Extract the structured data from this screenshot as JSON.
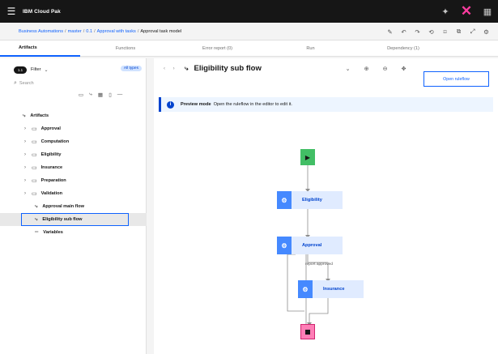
{
  "app": {
    "brand": "IBM Cloud Pak",
    "menu_icon": "hamburger-icon",
    "top_icons": [
      "pin-icon",
      "close-icon",
      "grid-icon"
    ]
  },
  "breadcrumb": {
    "items": [
      "Business Automations",
      "master",
      "0.1",
      "Approval with tasks"
    ],
    "current": "Approval task model",
    "tools": [
      "edit-icon",
      "undo-icon",
      "redo-icon",
      "history-icon",
      "tag-icon",
      "copy-icon",
      "fullscreen-icon",
      "settings-icon"
    ]
  },
  "tabs": [
    "Artifacts",
    "Functions",
    "Error report (0)",
    "Run",
    "Dependency (1)"
  ],
  "sidebar": {
    "toggle_label": "1.1",
    "filter_label": "Filter",
    "all_types": "All types",
    "search_placeholder": "Search",
    "tree": {
      "root": "Artifacts",
      "folders": [
        "Approval",
        "Computation",
        "Eligibility",
        "Insurance",
        "Preparation",
        "Validation"
      ],
      "flows": [
        "Approval main flow",
        "Eligibility sub flow"
      ],
      "variables": "Variables",
      "selected": "Eligibility sub flow"
    }
  },
  "editor": {
    "title": "Eligibility sub flow",
    "open_button": "Open ruleflow",
    "banner_bold": "Preview mode",
    "banner_text": "Open the ruleflow in the editor to edit it.",
    "tasks": [
      "Eligibility",
      "Approval",
      "Insurance"
    ],
    "edge_label": "report approved"
  },
  "colors": {
    "topbar": "#161616",
    "accent": "#0f62fe",
    "start_node": "#42be65",
    "end_node": "#ff7eb6",
    "task_icon": "#4589ff",
    "task_bg": "#e0ebff",
    "banner_bg": "#edf5ff"
  }
}
